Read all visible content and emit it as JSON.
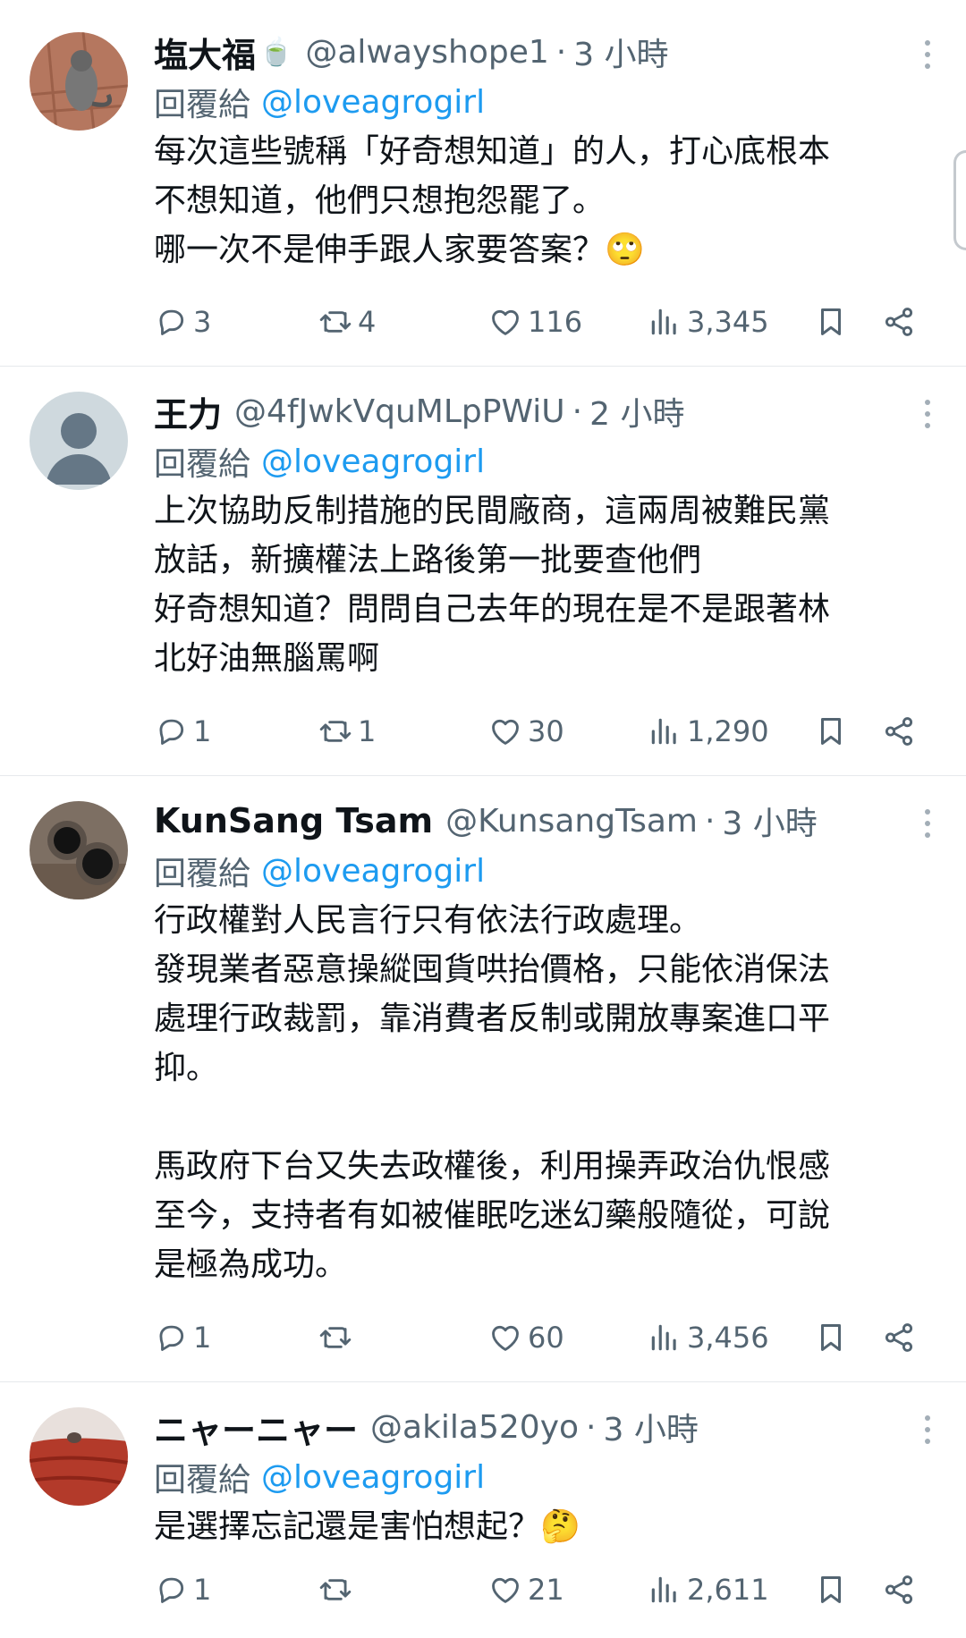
{
  "reply_label": "回覆給",
  "tweets": [
    {
      "display_name": "塩大福",
      "name_emoji": "🍵",
      "handle": "@alwayshope1",
      "separator": "·",
      "time": "3 小時",
      "reply_to": "@loveagrogirl",
      "text": "每次這些號稱「好奇想知道」的人，打心底根本\n不想知道，他們只想抱怨罷了。\n哪一次不是伸手跟人家要答案？🙄",
      "replies": "3",
      "retweets": "4",
      "likes": "116",
      "views": "3,345"
    },
    {
      "display_name": "王力",
      "name_emoji": "",
      "handle": "@4fJwkVquMLpPWiU",
      "separator": "·",
      "time": "2 小時",
      "reply_to": "@loveagrogirl",
      "text": "上次協助反制措施的民間廠商，這兩周被難民黨\n放話，新擴權法上路後第一批要查他們\n好奇想知道？問問自己去年的現在是不是跟著林\n北好油無腦罵啊",
      "replies": "1",
      "retweets": "1",
      "likes": "30",
      "views": "1,290"
    },
    {
      "display_name": "KunSang Tsam",
      "name_emoji": "",
      "handle": "@KunsangTsam",
      "separator": "·",
      "time": "3 小時",
      "reply_to": "@loveagrogirl",
      "text": "行政權對人民言行只有依法行政處理。\n發現業者惡意操縱囤貨哄抬價格，只能依消保法\n處理行政裁罰，靠消費者反制或開放專案進口平\n抑。\n\n馬政府下台又失去政權後，利用操弄政治仇恨感\n至今，支持者有如被催眠吃迷幻藥般隨從，可說\n是極為成功。",
      "replies": "1",
      "retweets": "",
      "likes": "60",
      "views": "3,456"
    },
    {
      "display_name": "ニャーニャー",
      "name_emoji": "",
      "handle": "@akila520yo",
      "separator": "·",
      "time": "3 小時",
      "reply_to": "@loveagrogirl",
      "text": "是選擇忘記還是害怕想起？🤔",
      "replies": "1",
      "retweets": "",
      "likes": "21",
      "views": "2,611"
    }
  ]
}
